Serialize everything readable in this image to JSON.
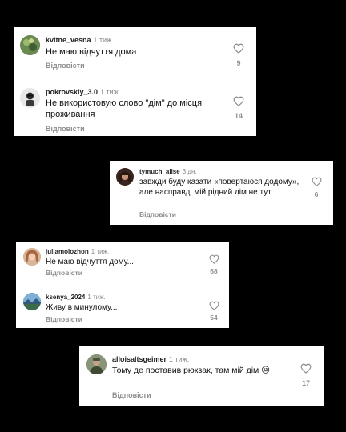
{
  "cards": [
    {
      "comments": [
        {
          "username": "kvitne_vesna",
          "time": "1 тиж.",
          "text": "Не маю відчуття дома",
          "reply": "Відповісти",
          "likes": "9",
          "avatar_color": "#5e7d4a"
        },
        {
          "username": "pokrovskiy_3.0",
          "time": "1 тиж.",
          "text": "Не використовую слово \"дім\" до місця проживання",
          "reply": "Відповісти",
          "likes": "14",
          "avatar_color": "#d9d9d9"
        }
      ]
    },
    {
      "comments": [
        {
          "username": "tymuch_alise",
          "time": "3 дн.",
          "text": "завжди буду казати «повертаюся додому», але насправді мій рідний дім не тут",
          "reply": "Відповісти",
          "likes": "6",
          "avatar_color": "#5a3a2e"
        }
      ]
    },
    {
      "comments": [
        {
          "username": "juliamolozhon",
          "time": "1 тиж.",
          "text": "Не маю відчуття дому...",
          "reply": "Відповісти",
          "likes": "68",
          "avatar_color": "#c79a7a"
        },
        {
          "username": "ksenya_2024",
          "time": "1 тиж.",
          "text": "Живу в минулому...",
          "reply": "Відповісти",
          "likes": "54",
          "avatar_color": "#4f7fa6"
        }
      ]
    },
    {
      "comments": [
        {
          "username": "alloisaltsgeimer",
          "time": "1 тиж.",
          "text": "Тому де поставив рюкзак, там мій дім 😔",
          "reply": "Відповісти",
          "likes": "17",
          "avatar_color": "#56604a"
        }
      ]
    }
  ]
}
